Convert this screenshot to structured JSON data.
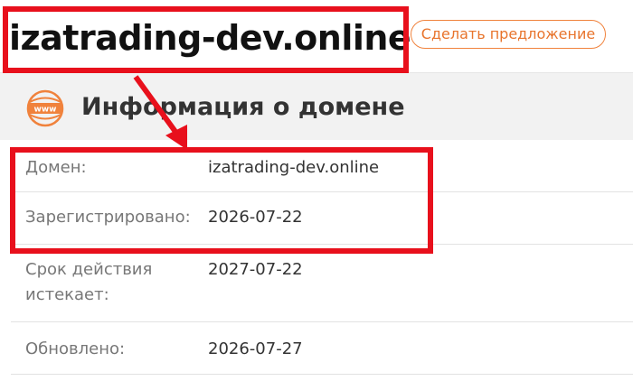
{
  "header": {
    "domain_title": "izatrading-dev.online",
    "offer_button_label": "Сделать предложение"
  },
  "section": {
    "icon_label": "www",
    "title": "Информация о домене"
  },
  "info": {
    "rows": [
      {
        "label": "Домен:",
        "value": "izatrading-dev.online"
      },
      {
        "label": "Зарегистрировано:",
        "value": "2026-07-22"
      },
      {
        "label": "Срок действия истекает:",
        "value": "2027-07-22"
      },
      {
        "label": "Обновлено:",
        "value": "2026-07-27"
      }
    ]
  },
  "colors": {
    "accent_orange": "#f0823c",
    "annotation_red": "#e8101c",
    "header_bg": "#f2f2f2"
  }
}
